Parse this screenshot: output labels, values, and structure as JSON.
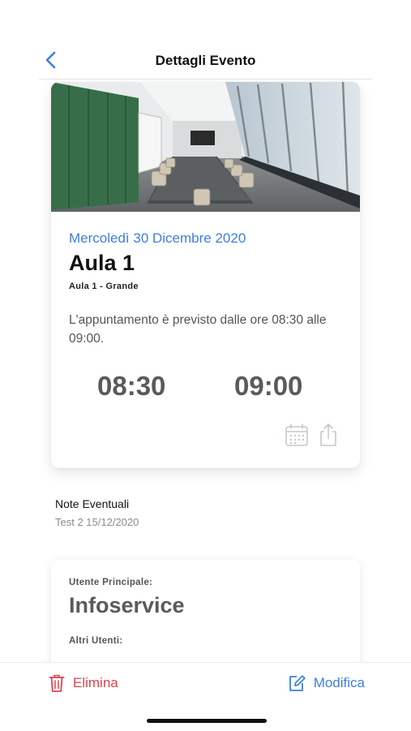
{
  "nav": {
    "title": "Dettagli Evento",
    "back_icon": "chevron-left-icon"
  },
  "event": {
    "date": "Mercoledì 30 Dicembre 2020",
    "room": "Aula 1",
    "room_detail": "Aula 1 - Grande",
    "description": "L'appuntamento è previsto dalle ore 08:30 alle 09:00.",
    "start_time": "08:30",
    "end_time": "09:00",
    "actions": [
      "calendar-add-icon",
      "share-icon"
    ]
  },
  "notes": {
    "label": "Note Eventuali",
    "value": "Test 2 15/12/2020"
  },
  "users": {
    "main_label": "Utente Principale:",
    "main_value": "Infoservice",
    "others_label": "Altri Utenti:"
  },
  "toolbar": {
    "delete_label": "Elimina",
    "edit_label": "Modifica"
  },
  "colors": {
    "accent": "#3d7fe0",
    "danger": "#e0424f",
    "time_text": "#5a5a5a"
  }
}
